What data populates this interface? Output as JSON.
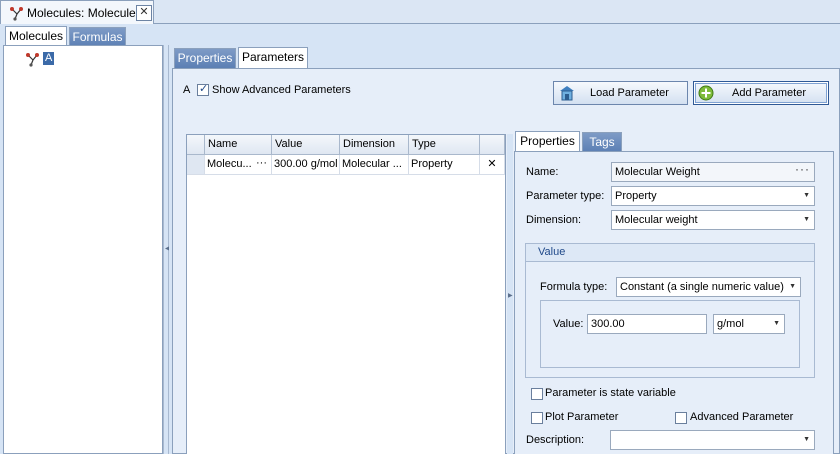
{
  "document_tab": {
    "title": "Molecules: Molecules",
    "close_glyph": "✕"
  },
  "main_tabs": [
    {
      "label": "Molecules",
      "active": true
    },
    {
      "label": "Formulas",
      "active": false
    }
  ],
  "tree": {
    "node_label": "A",
    "node_icon": "molecule-icon"
  },
  "sub_tabs": [
    {
      "label": "Properties",
      "active": false
    },
    {
      "label": "Parameters",
      "active": true
    }
  ],
  "toolbar": {
    "molecule_label": "A",
    "show_advanced_label": "Show Advanced Parameters",
    "show_advanced_checked": true,
    "load_button": "Load Parameter",
    "add_button": "Add Parameter"
  },
  "grid": {
    "columns": [
      "Name",
      "Value",
      "Dimension",
      "Type"
    ],
    "rows": [
      {
        "name": "Molecu...",
        "value": "300.00 g/mol",
        "dimension": "Molecular ...",
        "type": "Property"
      }
    ],
    "ellipsis": "···",
    "delete_glyph": "✕"
  },
  "detail_tabs": [
    {
      "label": "Properties",
      "active": true
    },
    {
      "label": "Tags",
      "active": false
    }
  ],
  "detail": {
    "name_label": "Name:",
    "name_value": "Molecular Weight",
    "param_type_label": "Parameter type:",
    "param_type_value": "Property",
    "dimension_label": "Dimension:",
    "dimension_value": "Molecular weight",
    "value_group_title": "Value",
    "formula_type_label": "Formula type:",
    "formula_type_value": "Constant (a single numeric value)",
    "value_label": "Value:",
    "value_value": "300.00",
    "unit_value": "g/mol",
    "state_variable_label": "Parameter is state variable",
    "plot_label": "Plot Parameter",
    "advanced_label": "Advanced Parameter",
    "description_label": "Description:",
    "description_value": ""
  },
  "colors": {
    "accent": "#3b6aa8",
    "tab_inactive": "#5b7fb4",
    "background": "#d6e4f5"
  }
}
